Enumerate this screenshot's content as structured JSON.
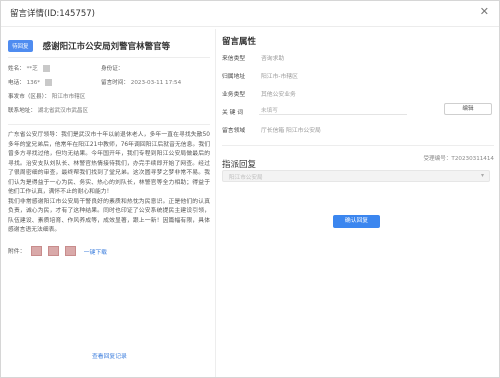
{
  "dialog": {
    "title": "留言详情(ID:145757)",
    "close_glyph": "✕"
  },
  "message": {
    "badge": "待回复",
    "title": "感谢阳江市公安局刘警官林警官等",
    "name_label": "姓名：",
    "name_value": "**芝",
    "id_label": "身份证：",
    "phone_label": "电话：",
    "phone_value": "136*",
    "time_label": "留言时间：",
    "time_value": "2023-03-11 17:54",
    "place_label": "事发市（区县）：",
    "place_value": "阳江市市辖区",
    "address_label": "联系地址：",
    "address_value": "湖北省武汉市武昌区",
    "content": "广东省公安厅领导：我们是武汉市十年以前退休老人，多年一直在寻找失散50多年的堂兄弟后，他常年在阳江21中教师，76年调回阳江后就音无信息。我们曾多方寻找过他，但均无结果。今年国开年，我们专程到阳江公安局做最后的寻找。治安支队刘队长、林警官热情接待我们，办完手续即开始了网查。经过了很周密细的审查，最终帮我们找到了堂兄弟。这次圆寻梦之梦非常不易。我们认为是得益于一心为民、务实、热心的刘队长，林警官等全力相助；得益于他们工作认真，满怀不止的耐心和能力！\n    我们非常感谢阳江市公安局干警良好的素质和热忱为民意识。正是他们的认真负责，诚心为民，才有了这种结果。同时也印证了公安系统提民主建设引领，队伍建设、素质培育、作风养成等，成效显著，跟上一新！因篇幅有限，具体感谢言语无法细表。",
    "attach_label": "附件：",
    "download_label": "一键下载",
    "reply_record_label": "查看回复记录"
  },
  "attributes": {
    "section_title": "留言属性",
    "source_label": "来信类型",
    "source_value": "咨询求助",
    "region_label": "归属地址",
    "region_value": "阳江市-市辖区",
    "business_label": "业务类型",
    "business_value": "其他公安业务",
    "keyword_label": "关 键 词",
    "keyword_placeholder": "未填写",
    "edit_label": "编辑",
    "dept_label": "留言领域",
    "dept_value": "厅长信箱 阳江市公安局"
  },
  "assign": {
    "section_title": "指派回复",
    "accept_no": "受理编号：T20230311414",
    "select_placeholder": "阳江市公安局",
    "select_arrow": "▾",
    "confirm_label": "确认回复"
  }
}
